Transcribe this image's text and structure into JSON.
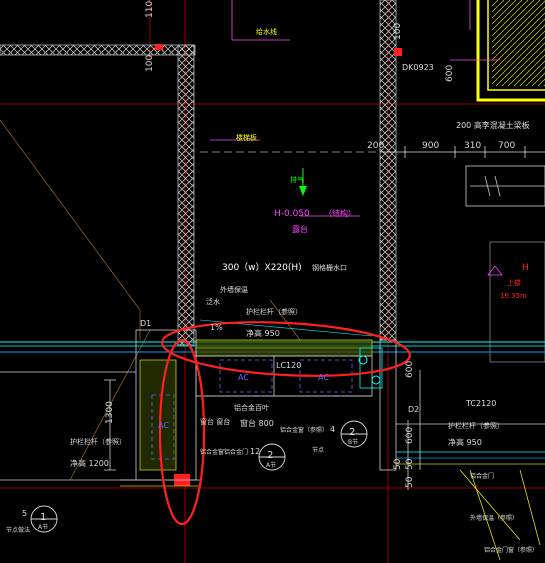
{
  "colors": {
    "background": "#000000",
    "wall": "#c8c8c8",
    "dim": "#d8d8d8",
    "grid": "#e00000",
    "cyan": "#00ffff",
    "green": "#00ff00",
    "yellow": "#ffff00",
    "magenta": "#ff44ff",
    "white": "#ffffff",
    "blue": "#6464ff",
    "highlight": "#ff2020"
  },
  "dims": {
    "top_1100": "1100",
    "left_100": "100",
    "right_100": "100",
    "r600": "600",
    "d200": "200",
    "d900": "900",
    "d310": "310",
    "d700": "700",
    "d1300": "1300",
    "d600b": "600",
    "d1100b": "1100",
    "d600c": "600",
    "d50a": "50",
    "d50b": "50",
    "d50c": "50",
    "d1300b": "1300"
  },
  "labels": {
    "top_note": "给水线",
    "dk0923": "DK0923",
    "beam_note": "200  高李混凝土梁板",
    "dashed_note": "楼梯板",
    "arrow_note": "排气",
    "h_level": "H-0.050",
    "h_level_note": "（结构）",
    "platform": "露台",
    "drain_size_a": "300（w）X220(H)",
    "drain_size_b": "钢格栅水口",
    "right_box_h": "H",
    "right_box_note": "上楼",
    "right_box_level": "16.35m",
    "steel_note": "外墙保温",
    "slope_note": "泛水",
    "rail_note": "护栏栏杆（参照）",
    "rail_slope": "1%",
    "rail_height": "净高  950",
    "d1_tag": "D1",
    "lc120": "LC120",
    "ac_a": "AC",
    "ac_b": "AC",
    "ac_c": "AC",
    "d2_tag": "D2",
    "tc2120": "TC2120",
    "rail2_note": "护栏栏杆（参照）",
    "rail2_height": "净高  950",
    "rail3_note": "护栏栏杆（参照）",
    "rail3_height": "净高  1200",
    "mid_note_a": "铝合金百叶",
    "mid_note_b": "窗台  800",
    "mid_note_c": "窗台  窗台",
    "mid_note_d": "铝合金窗（参照）",
    "mid_note_e": "铝合金窗铝合金门",
    "mid_note_f": "4",
    "mid_note_g": "12",
    "mid_note_h": "节点",
    "circle2_num": "2",
    "circle2_sub": "A节",
    "circle2b_num": "2",
    "circle2b_sub": "B节",
    "circle1_num": "1",
    "circle1_sub": "A节",
    "left_num_5": "5",
    "left_note_a": "节点做法",
    "bottom_right_a": "铝合金门",
    "bottom_right_b": "外墙保温（参照）",
    "bottom_right_c": "铝合金门窗（参照）"
  }
}
